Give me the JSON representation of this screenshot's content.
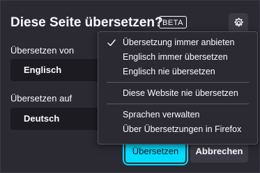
{
  "panel": {
    "title": "Diese Seite übersetzen?",
    "badge": "BETA",
    "settings_icon": "gear-icon"
  },
  "from": {
    "label": "Übersetzen von",
    "value": "Englisch"
  },
  "to": {
    "label": "Übersetzen auf",
    "value": "Deutsch"
  },
  "buttons": {
    "translate": "Übersetzen",
    "cancel": "Abbrechen"
  },
  "menu": {
    "items": [
      {
        "label": "Übersetzung immer anbieten",
        "checked": true
      },
      {
        "label": "Englisch immer übersetzen",
        "checked": false
      },
      {
        "label": "Englisch nie übersetzen",
        "checked": false
      },
      {
        "label": "Diese Website nie übersetzen",
        "checked": false
      },
      {
        "label": "Sprachen verwalten",
        "checked": false
      },
      {
        "label": "Über Übersetzungen in Firefox",
        "checked": false
      }
    ]
  },
  "colors": {
    "accent": "#00ddff",
    "background": "#2b2a33",
    "field": "#1c1b22"
  }
}
